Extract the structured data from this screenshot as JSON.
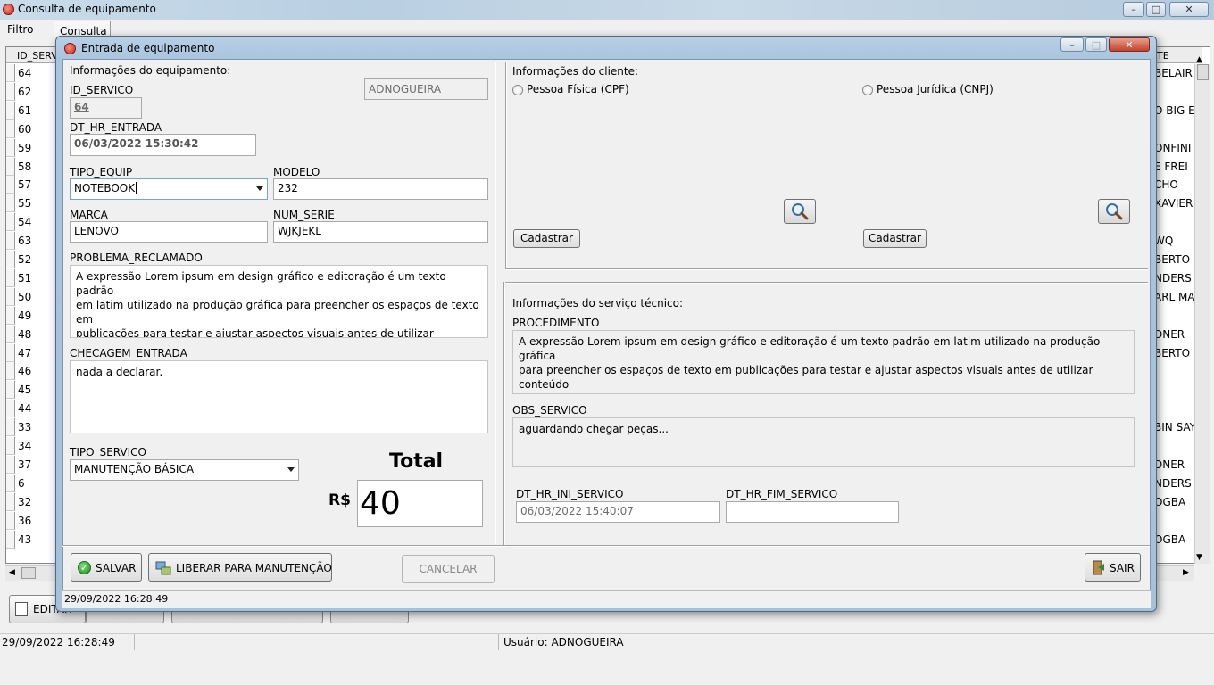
{
  "main_window": {
    "title": "Consulta de equipamento",
    "menu": [
      "Filtro",
      "Consulta"
    ],
    "grid_header_first": "ID_SERV",
    "grid_header_last": "TE",
    "grid_rows": [
      {
        "id": "64",
        "right": "BELAIR"
      },
      {
        "id": "62",
        "right": ""
      },
      {
        "id": "61",
        "right": "O BIG E"
      },
      {
        "id": "60",
        "right": ""
      },
      {
        "id": "59",
        "right": "ONFINI"
      },
      {
        "id": "58",
        "right": "E FREI"
      },
      {
        "id": "57",
        "right": "CHO"
      },
      {
        "id": "55",
        "right": "XAVIER"
      },
      {
        "id": "54",
        "right": ""
      },
      {
        "id": "63",
        "right": "WQ"
      },
      {
        "id": "52",
        "right": "BERTO"
      },
      {
        "id": "51",
        "right": "NDERS"
      },
      {
        "id": "50",
        "right": "ARL MA"
      },
      {
        "id": "49",
        "right": ""
      },
      {
        "id": "48",
        "right": "DNER"
      },
      {
        "id": "47",
        "right": "BERTO"
      },
      {
        "id": "46",
        "right": ""
      },
      {
        "id": "45",
        "right": ""
      },
      {
        "id": "44",
        "right": ""
      },
      {
        "id": "33",
        "right": "BIN SAY"
      },
      {
        "id": "34",
        "right": ""
      },
      {
        "id": "37",
        "right": "DNER"
      },
      {
        "id": "6",
        "right": "NDERS"
      },
      {
        "id": "32",
        "right": "OGBA"
      },
      {
        "id": "36",
        "right": ""
      },
      {
        "id": "43",
        "right": "OGBA"
      }
    ],
    "bottom_button_first": "EDITAR",
    "status_datetime": "29/09/2022 16:28:49",
    "status_user": "Usuário: ADNOGUEIRA"
  },
  "dialog": {
    "title": "Entrada de equipamento",
    "equipment": {
      "section_title": "Informações do equipamento:",
      "user_value": "ADNOGUEIRA",
      "id_servico_label": "ID_SERVICO",
      "id_servico_value": "64",
      "dt_hr_entrada_label": "DT_HR_ENTRADA",
      "dt_hr_entrada_value": "06/03/2022 15:30:42",
      "tipo_equip_label": "TIPO_EQUIP",
      "tipo_equip_value": "NOTEBOOK",
      "modelo_label": "MODELO",
      "modelo_value": "232",
      "marca_label": "MARCA",
      "marca_value": "LENOVO",
      "num_serie_label": "NUM_SERIE",
      "num_serie_value": "WJKJEKL",
      "problema_label": "PROBLEMA_RECLAMADO",
      "problema_value": "A expressão Lorem ipsum em design gráfico e editoração é um texto padrão\nem latim utilizado na produção gráfica para preencher os espaços de texto em\npublicações para testar e ajustar aspectos visuais antes de utilizar conteúdo\nreal.",
      "checagem_label": "CHECAGEM_ENTRADA",
      "checagem_value": "nada a declarar.",
      "tipo_servico_label": "TIPO_SERVICO",
      "tipo_servico_value": "MANUTENÇÃO BÁSICA",
      "total_label": "Total",
      "currency": "R$",
      "total_value": "40"
    },
    "client": {
      "section_title": "Informações do cliente:",
      "pf_label": "Pessoa Física (CPF)",
      "pj_label": "Pessoa Jurídica (CNPJ)",
      "cadastrar_pf": "Cadastrar",
      "cadastrar_pj": "Cadastrar"
    },
    "service": {
      "section_title": "Informações do serviço técnico:",
      "procedimento_label": "PROCEDIMENTO",
      "procedimento_value": "A expressão Lorem ipsum em design gráfico e editoração é um texto padrão em latim utilizado na produção gráfica\npara preencher os espaços de texto em publicações para testar e ajustar aspectos visuais antes de utilizar conteúdo\nreal.",
      "obs_label": "OBS_SERVICO",
      "obs_value": "aguardando chegar peças...",
      "dt_ini_label": "DT_HR_INI_SERVICO",
      "dt_ini_value": "06/03/2022 15:40:07",
      "dt_fim_label": "DT_HR_FIM_SERVICO",
      "dt_fim_value": ""
    },
    "buttons": {
      "salvar": "SALVAR",
      "liberar": "LIBERAR PARA MANUTENÇÃO",
      "cancelar": "CANCELAR",
      "sair": "SAIR"
    },
    "status_datetime": "29/09/2022 16:28:49"
  }
}
